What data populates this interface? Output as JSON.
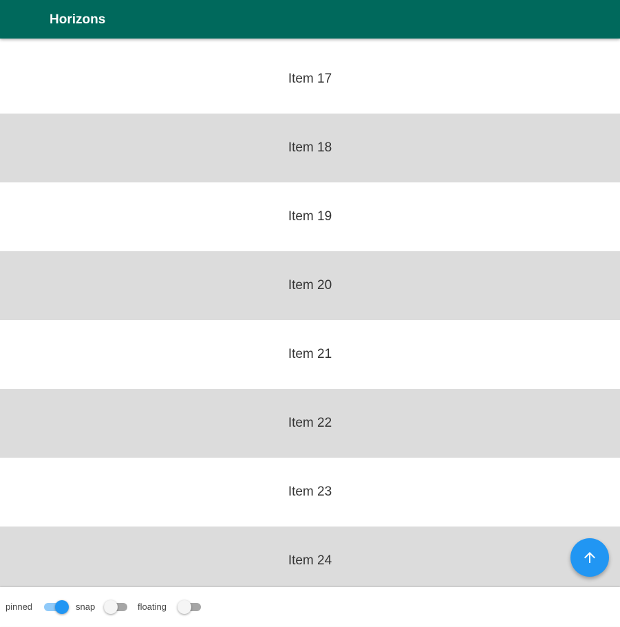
{
  "app": {
    "title": "Horizons"
  },
  "list": {
    "items": [
      {
        "label": "Item 17"
      },
      {
        "label": "Item 18"
      },
      {
        "label": "Item 19"
      },
      {
        "label": "Item 20"
      },
      {
        "label": "Item 21"
      },
      {
        "label": "Item 22"
      },
      {
        "label": "Item 23"
      },
      {
        "label": "Item 24"
      }
    ]
  },
  "options": {
    "pinned": {
      "label": "pinned",
      "checked": true
    },
    "snap": {
      "label": "snap",
      "checked": false
    },
    "floating": {
      "label": "floating",
      "checked": false
    }
  },
  "fab": {
    "icon": "arrow-up-icon"
  },
  "colors": {
    "appbar": "#00695c",
    "accent": "#2196f3",
    "row_alt": "#dcdcdc"
  }
}
